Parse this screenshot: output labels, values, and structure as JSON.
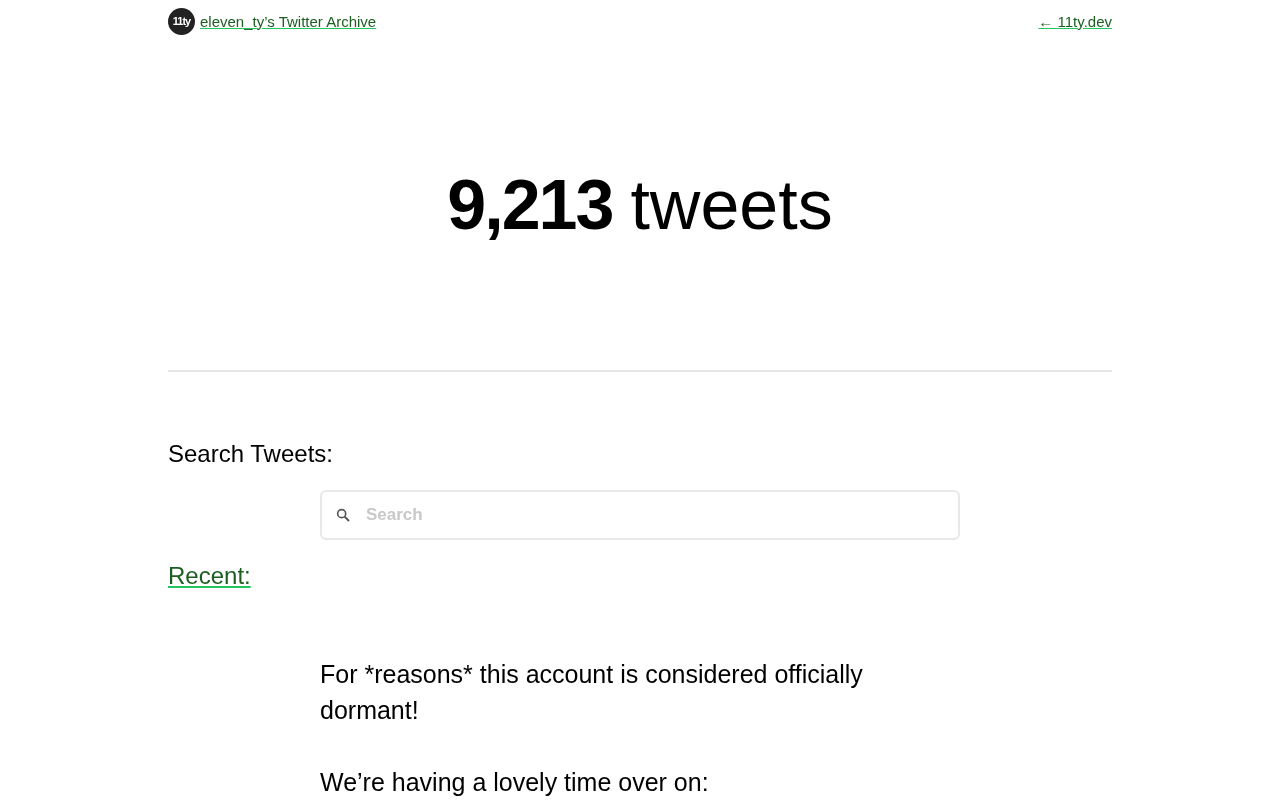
{
  "header": {
    "logo": "11ty",
    "title_link": "eleven_ty’s Twitter Archive",
    "home_link": "← 11ty.dev"
  },
  "headline": {
    "count": "9,213",
    "unit": "tweets"
  },
  "search": {
    "label": "Search Tweets:",
    "placeholder": "Search"
  },
  "recent": {
    "link": "Recent:"
  },
  "tweet": {
    "paragraphs": [
      "For *reasons* this account is considered officially dormant!",
      "We’re having a lovely time over on:"
    ]
  }
}
